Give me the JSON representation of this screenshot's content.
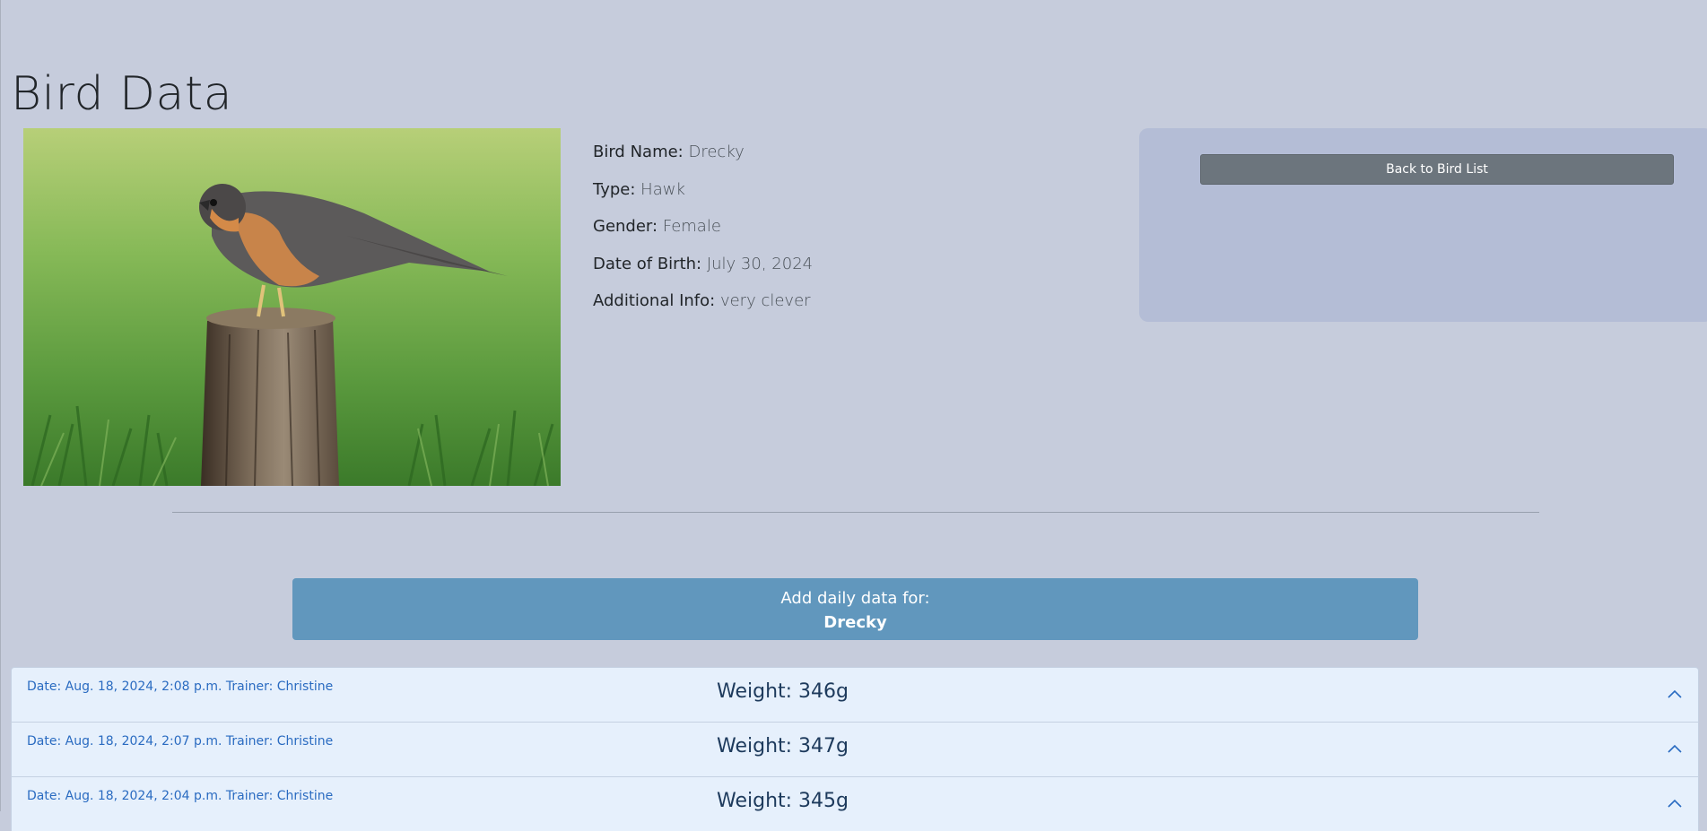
{
  "page": {
    "title": "Bird Data"
  },
  "bird": {
    "photo_alt": "Hawk perched on a tree stump",
    "fields": [
      {
        "label": "Bird Name:",
        "value": "Drecky"
      },
      {
        "label": "Type:",
        "value": "Hawk"
      },
      {
        "label": "Gender:",
        "value": "Female"
      },
      {
        "label": "Date of Birth:",
        "value": "July 30, 2024"
      },
      {
        "label": "Additional Info:",
        "value": "very clever"
      }
    ]
  },
  "side_panel": {
    "back_label": "Back to Bird List"
  },
  "add_data": {
    "prefix": "Add daily data for:",
    "bird_name": "Drecky"
  },
  "records": [
    {
      "meta": "Date: Aug. 18, 2024, 2:08 p.m. Trainer: Christine",
      "weight": "Weight: 346g"
    },
    {
      "meta": "Date: Aug. 18, 2024, 2:07 p.m. Trainer: Christine",
      "weight": "Weight: 347g"
    },
    {
      "meta": "Date: Aug. 18, 2024, 2:04 p.m. Trainer: Christine",
      "weight": "Weight: 345g"
    }
  ],
  "icons": {
    "record_toggle": "chevron-up-icon"
  }
}
